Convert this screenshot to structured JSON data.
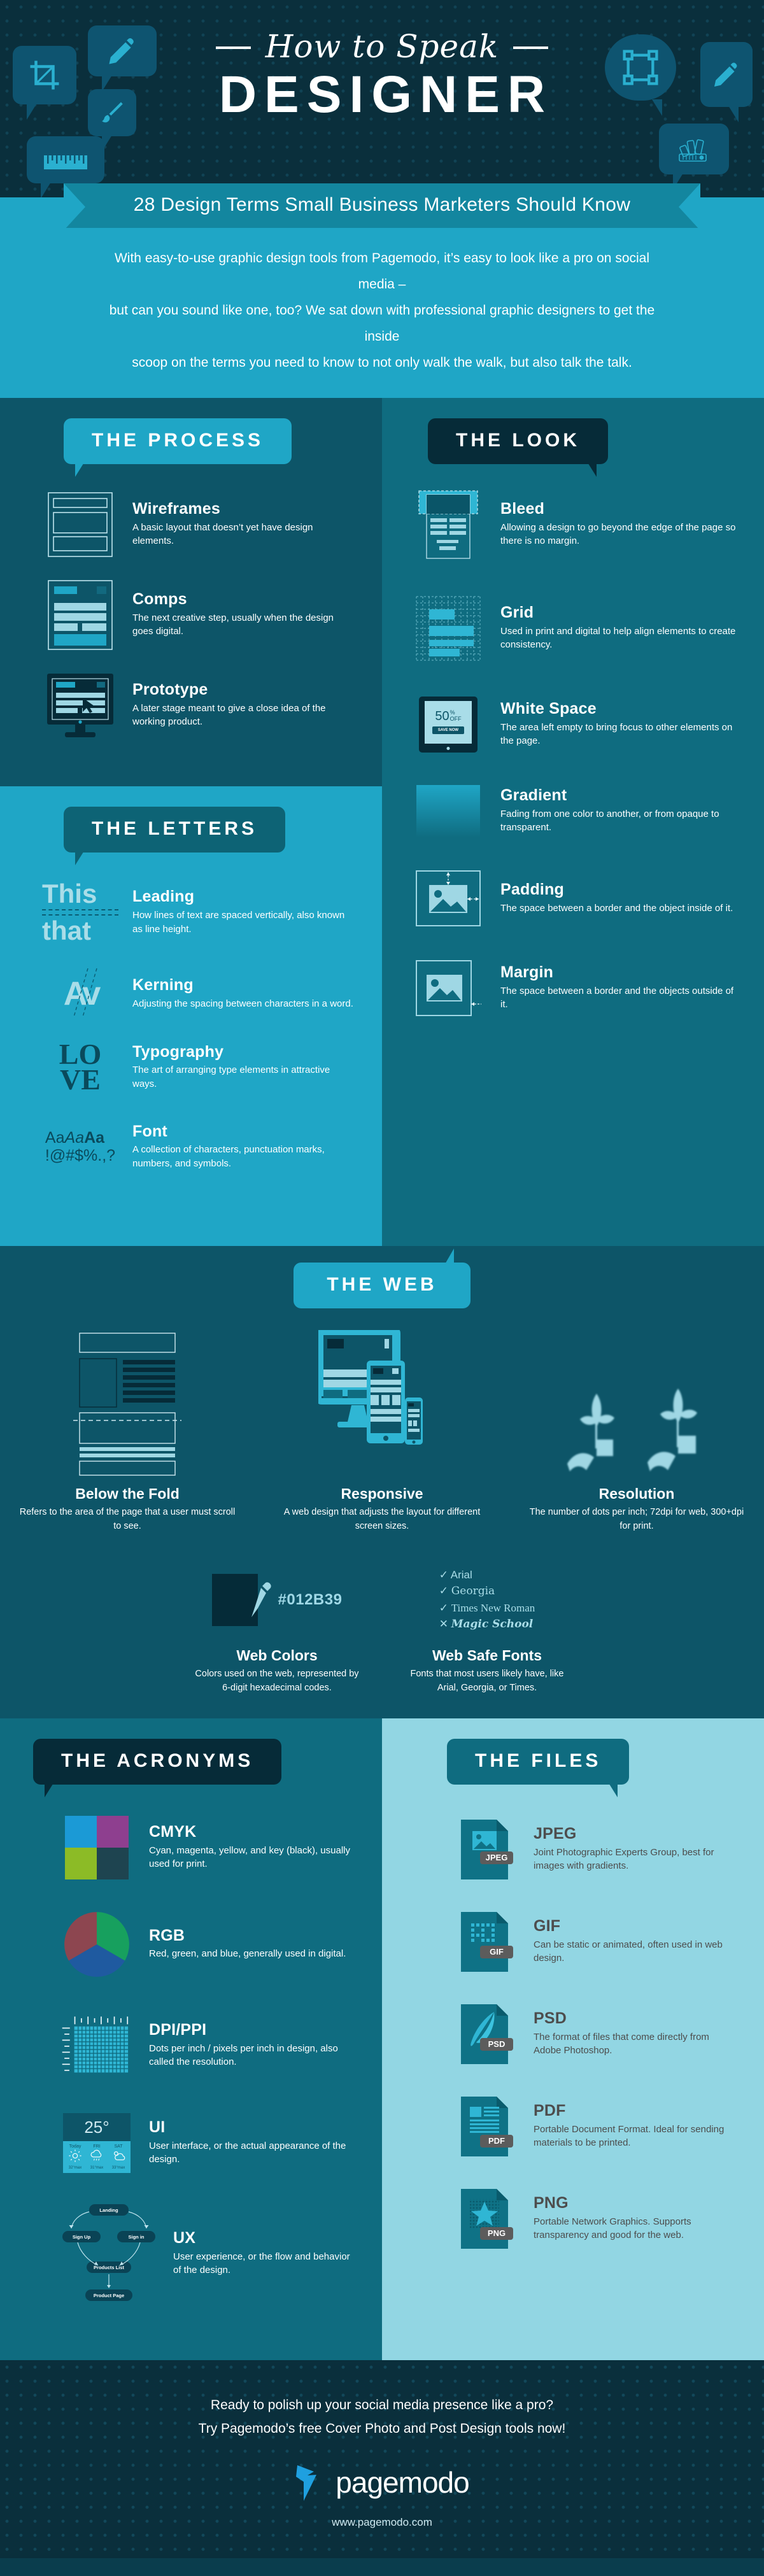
{
  "header": {
    "script_title": "How to Speak",
    "main_title": "DESIGNER",
    "icons": [
      "crop-icon",
      "pen-icon",
      "paintbrush-icon",
      "ruler-icon",
      "vector-node-icon",
      "pencil-icon",
      "color-swatch-fan-icon"
    ]
  },
  "ribbon": {
    "text": "28 Design Terms Small Business Marketers Should Know"
  },
  "intro": {
    "line1": "With easy-to-use graphic design tools from Pagemodo, it’s easy to look like a pro on social media –",
    "line2": "but can you sound like one, too? We sat down with professional graphic designers to get the inside",
    "line3": "scoop on the terms you need to know to not only walk the walk, but also talk the talk."
  },
  "sections": {
    "process": {
      "title": "THE PROCESS",
      "terms": [
        {
          "name": "Wireframes",
          "desc": "A basic layout that doesn’t yet have design elements.",
          "icon": "wireframe-icon"
        },
        {
          "name": "Comps",
          "desc": "The next creative step, usually when the design goes digital.",
          "icon": "comp-layout-icon"
        },
        {
          "name": "Prototype",
          "desc": "A later stage meant to give a close idea of the working product.",
          "icon": "monitor-prototype-icon"
        }
      ]
    },
    "look": {
      "title": "THE LOOK",
      "terms": [
        {
          "name": "Bleed",
          "desc": "Allowing a design to go beyond the edge of the page so there is no margin.",
          "icon": "bleed-page-icon"
        },
        {
          "name": "Grid",
          "desc": "Used in print and digital to help align elements to create consistency.",
          "icon": "grid-icon"
        },
        {
          "name": "White Space",
          "desc": "The area left empty to bring focus to other elements on the page.",
          "icon": "tablet-whitespace-icon",
          "art_text": {
            "offer": "50",
            "pct": "%",
            "off": "OFF",
            "button": "SAVE NOW"
          }
        },
        {
          "name": "Gradient",
          "desc": "Fading from one color to another, or from opaque to transparent.",
          "icon": "gradient-swatch-icon"
        },
        {
          "name": "Padding",
          "desc": "The space between a border and the object inside of it.",
          "icon": "padding-image-icon"
        },
        {
          "name": "Margin",
          "desc": "The space between a border and the objects outside of it.",
          "icon": "margin-image-icon"
        }
      ]
    },
    "letters": {
      "title": "THE LETTERS",
      "terms": [
        {
          "name": "Leading",
          "desc": "How lines of text are spaced vertically, also known as line height.",
          "icon": "leading-icon",
          "art_text": {
            "l1": "This",
            "l2": "that"
          }
        },
        {
          "name": "Kerning",
          "desc": "Adjusting the spacing between characters in a word.",
          "icon": "kerning-icon",
          "art_text": {
            "glyphs": "Av"
          }
        },
        {
          "name": "Typography",
          "desc": "The art of arranging type elements in attractive ways.",
          "icon": "love-typography-icon",
          "art_text": {
            "top": "LO",
            "bottom": "VE"
          }
        },
        {
          "name": "Font",
          "desc": "A collection of characters, punctuation marks, numbers, and symbols.",
          "icon": "font-sample-icon",
          "art_text": {
            "l1a": "Aa",
            "l1b": "Aa",
            "l1c": "Aa",
            "l2": "!@#$%.,?"
          }
        }
      ]
    },
    "web": {
      "title": "THE WEB",
      "terms": [
        {
          "name": "Below the Fold",
          "desc": "Refers to the area of the page that a user must scroll to see.",
          "icon": "below-the-fold-icon"
        },
        {
          "name": "Responsive",
          "desc": "A web design that adjusts the layout for different screen sizes.",
          "icon": "responsive-devices-icon"
        },
        {
          "name": "Resolution",
          "desc": "The number of dots per inch; 72dpi for web, 300+dpi for print.",
          "icon": "plant-resolution-icon"
        }
      ],
      "terms2": [
        {
          "name": "Web Colors",
          "desc": "Colors used on the web, represented by 6-digit hexadecimal codes.",
          "icon": "eyedropper-icon",
          "hex": "#012B39"
        },
        {
          "name": "Web Safe Fonts",
          "desc": "Fonts that most users likely have, like Arial, Georgia, or Times.",
          "icon": "font-list-icon",
          "fonts": [
            {
              "mark": "✓",
              "label": "Arial"
            },
            {
              "mark": "✓",
              "label": "Georgia"
            },
            {
              "mark": "✓",
              "label": "Times New Roman"
            },
            {
              "mark": "✕",
              "label": "Magic School"
            }
          ]
        }
      ]
    },
    "acronyms": {
      "title": "THE ACRONYMS",
      "terms": [
        {
          "name": "CMYK",
          "desc": "Cyan, magenta, yellow, and key (black), usually used for print.",
          "icon": "cmyk-swatch-icon",
          "colors": [
            "#1b9ad6",
            "#8e3f8f",
            "#8cbb26",
            "#1e4450"
          ]
        },
        {
          "name": "RGB",
          "desc": "Red, green, and blue, generally used in digital.",
          "icon": "rgb-pie-icon",
          "colors": [
            "#8d4650",
            "#17a05e",
            "#1f5aa0"
          ]
        },
        {
          "name": "DPI/PPI",
          "desc": "Dots per inch / pixels per inch in design, also called the resolution.",
          "icon": "dpi-grid-ruler-icon"
        },
        {
          "name": "UI",
          "desc": "User interface, or the actual appearance of the design.",
          "icon": "weather-widget-icon",
          "art_text": {
            "temp": "25°",
            "d1": "Today",
            "d2": "FRI",
            "d3": "SAT",
            "h1": "32°max",
            "h2": "31°max",
            "h3": "33°max"
          }
        },
        {
          "name": "UX",
          "desc": "User experience, or the flow and behavior of the design.",
          "icon": "user-flow-icon",
          "art_text": {
            "n1": "Landing",
            "n2": "Sign Up",
            "n3": "Sign in",
            "n4": "Products List",
            "n5": "Product Page"
          }
        }
      ]
    },
    "files": {
      "title": "THE FILES",
      "terms": [
        {
          "name": "JPEG",
          "desc": "Joint Photographic Experts Group, best for images with gradients.",
          "icon": "jpeg-file-icon",
          "badge": "JPEG"
        },
        {
          "name": "GIF",
          "desc": "Can be static or animated, often used in web design.",
          "icon": "gif-file-icon",
          "badge": "GIF"
        },
        {
          "name": "PSD",
          "desc": "The format of files that come directly from Adobe Photoshop.",
          "icon": "psd-file-icon",
          "badge": "PSD"
        },
        {
          "name": "PDF",
          "desc": "Portable Document Format. Ideal for sending materials to be printed.",
          "icon": "pdf-file-icon",
          "badge": "PDF"
        },
        {
          "name": "PNG",
          "desc": "Portable Network Graphics. Supports transparency and good for the web.",
          "icon": "png-file-icon",
          "badge": "PNG"
        }
      ]
    }
  },
  "footer": {
    "cta_line1": "Ready to polish up your social media presence like a pro?",
    "cta_line2": "Try Pagemodo’s free Cover Photo and Post Design tools now!",
    "brand": "pagemodo",
    "url": "www.pagemodo.com",
    "logo_icon": "pagemodo-bird-icon"
  },
  "colors": {
    "deep_navy": "#0a2f3c",
    "deep_teal": "#0d5568",
    "teal": "#0f6c80",
    "cyan": "#1fa6c6",
    "light_blue": "#92d6e3",
    "pale": "#a9dde8",
    "brand_blue": "#1fa0e0"
  }
}
